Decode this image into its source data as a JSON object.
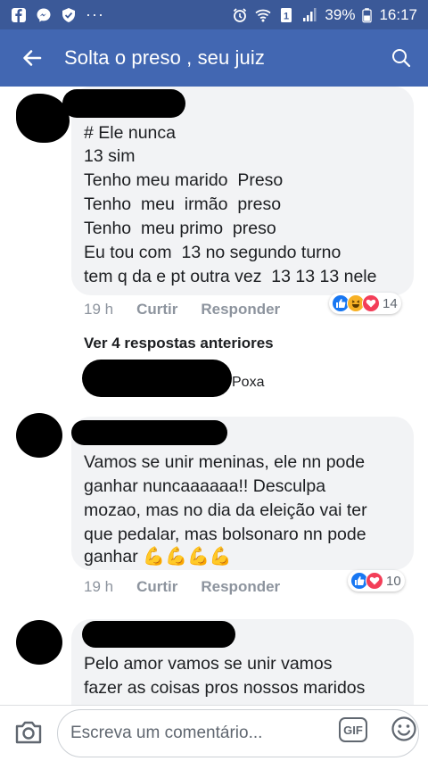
{
  "status": {
    "battery": "39%",
    "time": "16:17",
    "dots": "···"
  },
  "header": {
    "title": "Solta o preso , seu juiz"
  },
  "comments": [
    {
      "lines": [
        "# Ele nunca",
        "13 sim",
        "Tenho meu marido  Preso",
        "Tenho  meu  irmão  preso",
        "Tenho  meu primo  preso",
        "Eu tou com  13 no segundo turno",
        "tem q da e pt outra vez  13 13 13 nele"
      ],
      "time": "19 h",
      "like": "Curtir",
      "reply": "Responder",
      "reaction_count": "14"
    },
    {
      "lines": [
        "Vamos se unir meninas, ele nn pode",
        "ganhar nuncaaaaaa!! Desculpa",
        "mozao, mas no dia da eleição vai ter",
        "que pedalar, mas bolsonaro nn pode",
        "ganhar"
      ],
      "time": "19 h",
      "like": "Curtir",
      "reply": "Responder",
      "reaction_count": "10"
    },
    {
      "lines": [
        "Pelo amor vamos se unir vamos",
        "fazer as coisas pros nossos maridos"
      ]
    }
  ],
  "replies": {
    "more_label": "Ver 4 respostas anteriores",
    "reply_preview": "Poxa"
  },
  "composer": {
    "placeholder": "Escreva um comentário...",
    "gif_label": "GIF"
  },
  "colors": {
    "brand": "#4267b2",
    "statusbar": "#3b5998",
    "bubble": "#f2f3f5",
    "like_blue": "#1877f2",
    "love_red": "#f33e58",
    "haha_yellow": "#f7b125"
  }
}
